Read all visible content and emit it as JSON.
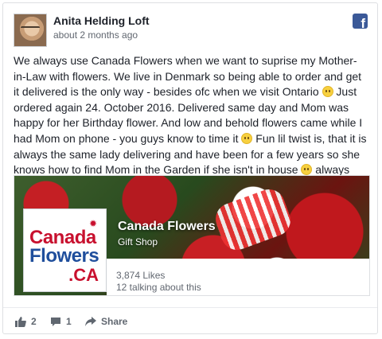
{
  "post": {
    "author": "Anita Helding Loft",
    "timestamp": "about 2 months ago",
    "text_segments": [
      "We always use Canada Flowers when we want to suprise my Mother-in-Law with flowers. We live in Denmark so being able to order and get it delivered is the only way - besides ofc when we visit Ontario ",
      " Just ordered again 24. October 2016. Delivered same day and Mom was happy for her Birthday flower. And low and behold flowers came while I had Mom on phone - you guys know to time it ",
      " Fun lil twist is, that it is always the same lady delivering and have been for a few years so she knows how to find Mom in the Garden if she isn't in house ",
      " always nice and fresh flowers "
    ],
    "emoji_icons": [
      "smile-emoji-icon",
      "tongue-emoji-icon",
      "smile-emoji-icon",
      "smile-emoji-icon"
    ]
  },
  "page_preview": {
    "name": "Canada Flowers",
    "category": "Gift Shop",
    "likes": "3,874 Likes",
    "talking": "12 talking about this",
    "logo": {
      "line1": "Canada",
      "line2": "Flowers",
      "line3": ".CA"
    }
  },
  "actions": {
    "like_count": "2",
    "comment_count": "1",
    "share_label": "Share"
  },
  "colors": {
    "facebook_blue": "#3b5998",
    "logo_red": "#c8102e",
    "logo_blue": "#1f4e9c",
    "text_primary": "#1d2129",
    "text_secondary": "#616770"
  }
}
